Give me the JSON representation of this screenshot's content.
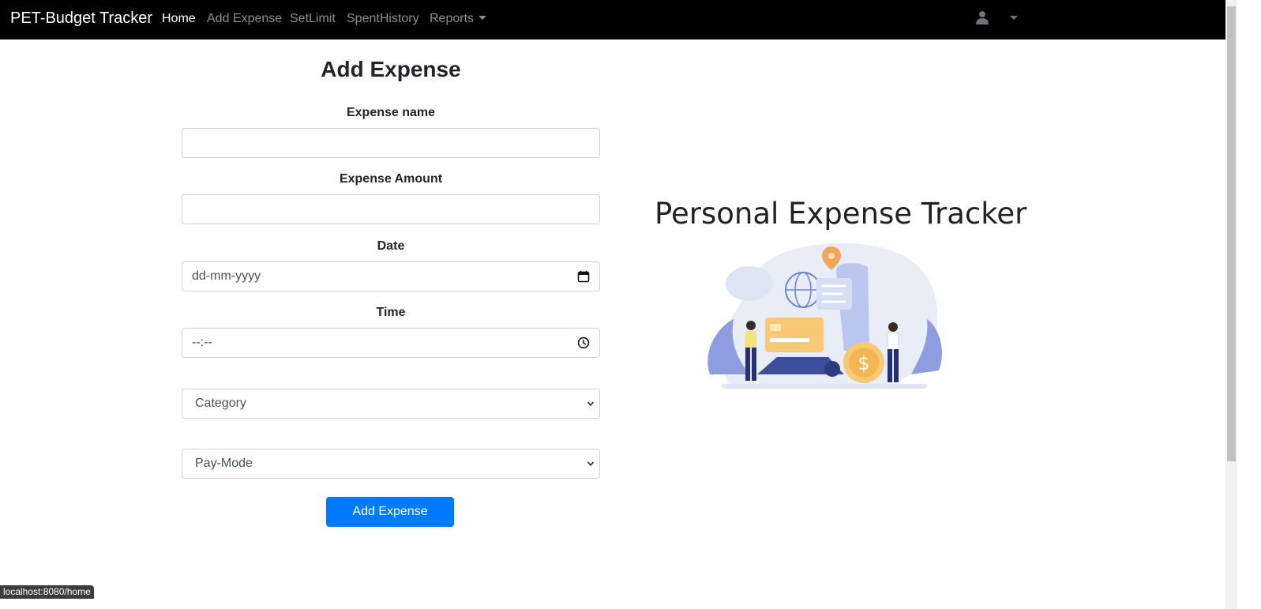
{
  "navbar": {
    "brand": "PET-Budget Tracker",
    "links": [
      {
        "label": "Home",
        "active": true
      },
      {
        "label": "Add Expense",
        "active": false
      },
      {
        "label": "SetLimit",
        "active": false
      },
      {
        "label": "SpentHistory",
        "active": false
      },
      {
        "label": "Reports",
        "active": false,
        "dropdown": true
      }
    ],
    "user_icon": "user-icon",
    "background": "#000000"
  },
  "form": {
    "title": "Add Expense",
    "fields": {
      "expense_name": {
        "label": "Expense name",
        "value": ""
      },
      "expense_amount": {
        "label": "Expense Amount",
        "value": ""
      },
      "date": {
        "label": "Date",
        "placeholder": "dd-mm-yyyy",
        "icon": "calendar-icon"
      },
      "time": {
        "label": "Time",
        "placeholder": "--:--",
        "icon": "clock-icon"
      },
      "category": {
        "selected": "Category"
      },
      "pay_mode": {
        "selected": "Pay-Mode"
      }
    },
    "submit_label": "Add Expense",
    "accent_color": "#007bff"
  },
  "hero": {
    "title": "Personal Expense Tracker",
    "illustration": "payment-illustration"
  },
  "status_bar": {
    "url": "localhost:8080/home"
  }
}
